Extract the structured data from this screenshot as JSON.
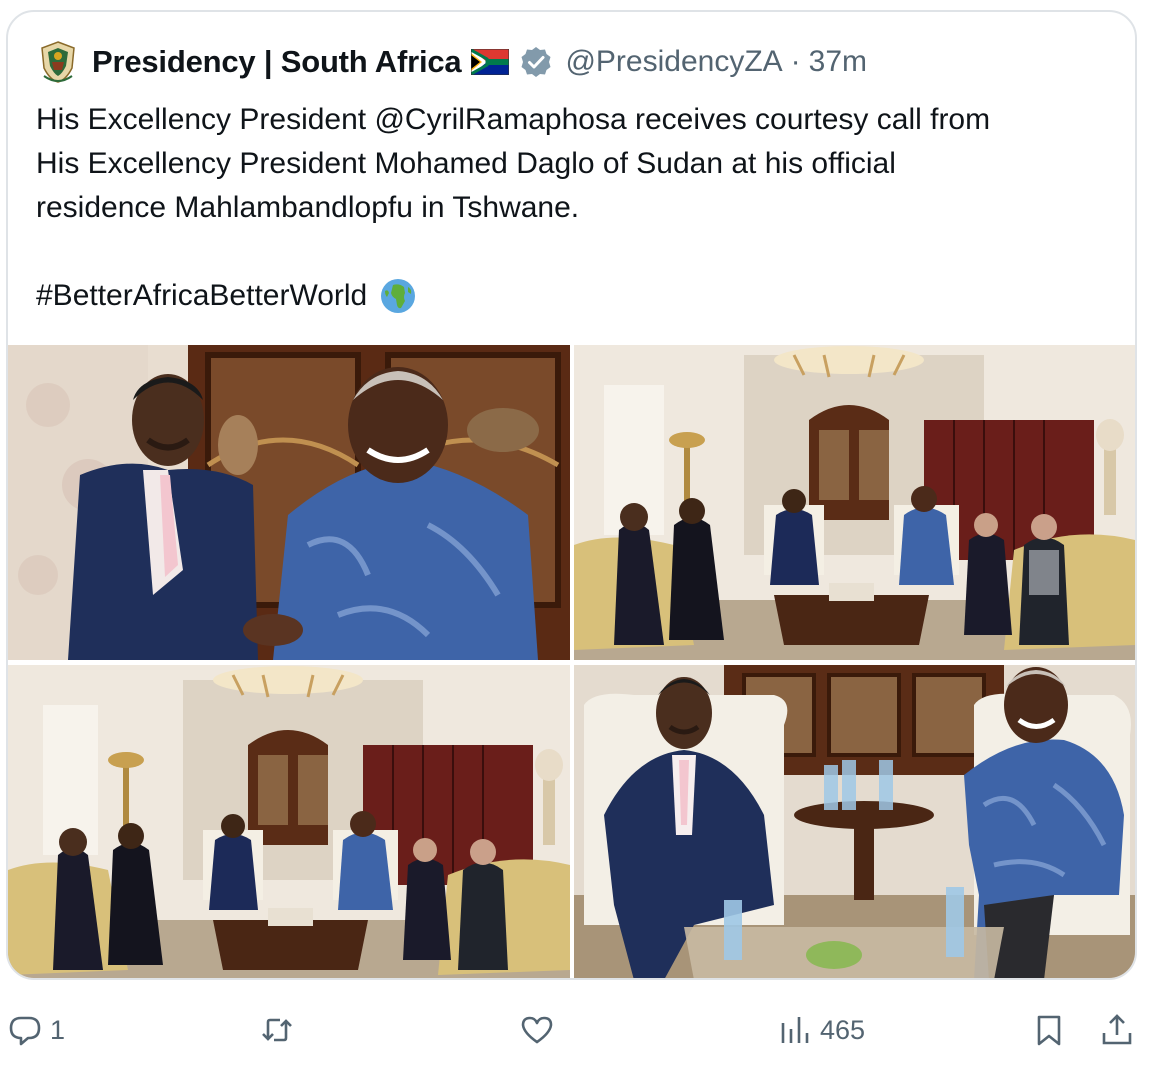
{
  "tweet": {
    "author": {
      "display_name": "Presidency | South Africa",
      "handle": "@PresidencyZA",
      "separator": "·",
      "time": "37m",
      "avatar_icon": "coat-of-arms-icon",
      "flag_icon": "south-africa-flag-icon",
      "verified_icon": "verified-badge-icon"
    },
    "text_lines": [
      "His Excellency President @CyrilRamaphosa receives courtesy call  from",
      "His Excellency President Mohamed Daglo of Sudan at his official",
      "residence Mahlambandlopfu in Tshwane."
    ],
    "hashtag": "#BetterAfricaBetterWorld",
    "hashtag_emoji_icon": "globe-africa-icon",
    "photos": [
      {
        "icon": "photo-handshake"
      },
      {
        "icon": "photo-meeting-room-wide"
      },
      {
        "icon": "photo-meeting-room-wide-2"
      },
      {
        "icon": "photo-two-presidents-seated"
      }
    ],
    "actions": {
      "reply": {
        "icon": "reply-icon",
        "count": "1"
      },
      "retweet": {
        "icon": "retweet-icon",
        "count": ""
      },
      "like": {
        "icon": "like-icon",
        "count": ""
      },
      "views": {
        "icon": "views-icon",
        "count": "465"
      },
      "bookmark": {
        "icon": "bookmark-icon"
      },
      "share": {
        "icon": "share-icon"
      }
    }
  },
  "colors": {
    "text": "#0f1419",
    "secondary_text": "#536471",
    "verified": "#829aab",
    "border": "#dfe3e7"
  }
}
